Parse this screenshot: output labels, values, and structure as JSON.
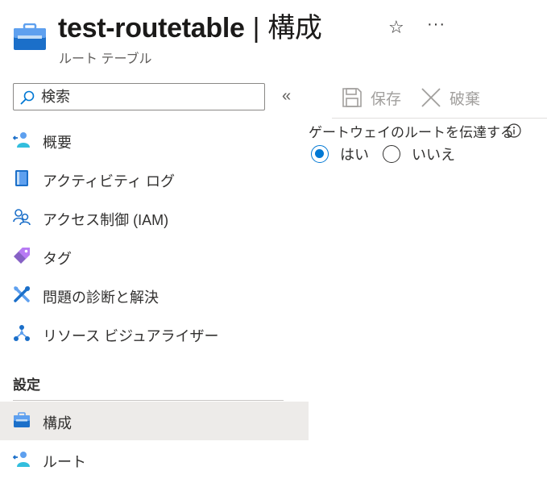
{
  "header": {
    "resource_icon": "route-table-icon",
    "resource_name": "test-routetable",
    "separator": "|",
    "page_name": "構成",
    "subtitle": "ルート テーブル",
    "favorite_icon": "star-icon",
    "more_icon": "more-icon"
  },
  "search": {
    "placeholder": "検索",
    "icon": "search-icon"
  },
  "collapse_label": "«",
  "nav": {
    "items": [
      {
        "label": "概要",
        "icon": "overview-icon"
      },
      {
        "label": "アクティビティ ログ",
        "icon": "activity-log-icon"
      },
      {
        "label": "アクセス制御 (IAM)",
        "icon": "iam-icon"
      },
      {
        "label": "タグ",
        "icon": "tag-icon"
      },
      {
        "label": "問題の診断と解決",
        "icon": "diagnose-icon"
      },
      {
        "label": "リソース ビジュアライザー",
        "icon": "resource-visualizer-icon"
      }
    ],
    "section_title": "設定",
    "settings_items": [
      {
        "label": "構成",
        "icon": "configuration-icon",
        "active": true
      },
      {
        "label": "ルート",
        "icon": "routes-icon",
        "active": false
      }
    ]
  },
  "toolbar": {
    "save_label": "保存",
    "discard_label": "破棄"
  },
  "form": {
    "propagate_label": "ゲートウェイのルートを伝達する",
    "info_icon": "info-icon",
    "options": [
      {
        "label": "はい",
        "checked": true
      },
      {
        "label": "いいえ",
        "checked": false
      }
    ]
  },
  "colors": {
    "accent": "#0078d4",
    "active_nav_bg": "#edebe9",
    "disabled_text": "#a19f9d"
  }
}
